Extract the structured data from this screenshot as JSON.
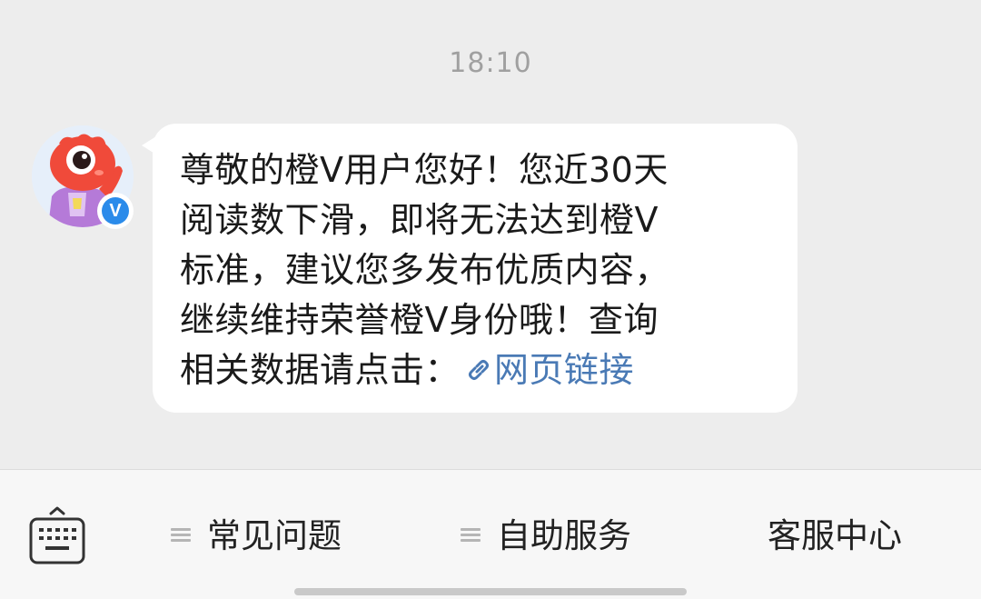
{
  "chat": {
    "timestamp": "18:10",
    "avatar_icon": "orange-mascot-avatar",
    "verified_badge": "V",
    "message": {
      "lines": [
        "尊敬的橙V用户您好！您近30天",
        "阅读数下滑，即将无法达到橙V",
        "标准，建议您多发布优质内容，",
        "继续维持荣誉橙V身份哦！查询"
      ],
      "last_line_prefix": "相关数据请点击：",
      "link_text": "网页链接",
      "link_icon": "link-icon"
    }
  },
  "bottom_bar": {
    "keyboard_icon": "keyboard-icon",
    "menu_items": [
      {
        "label": "常见问题",
        "icon": "menu-lines-icon"
      },
      {
        "label": "自助服务",
        "icon": "menu-lines-icon"
      },
      {
        "label": "客服中心"
      }
    ]
  },
  "colors": {
    "background": "#ededed",
    "bubble": "#ffffff",
    "link": "#4a7ab5",
    "verified": "#2b8bea",
    "mascot": "#f04a3a"
  }
}
